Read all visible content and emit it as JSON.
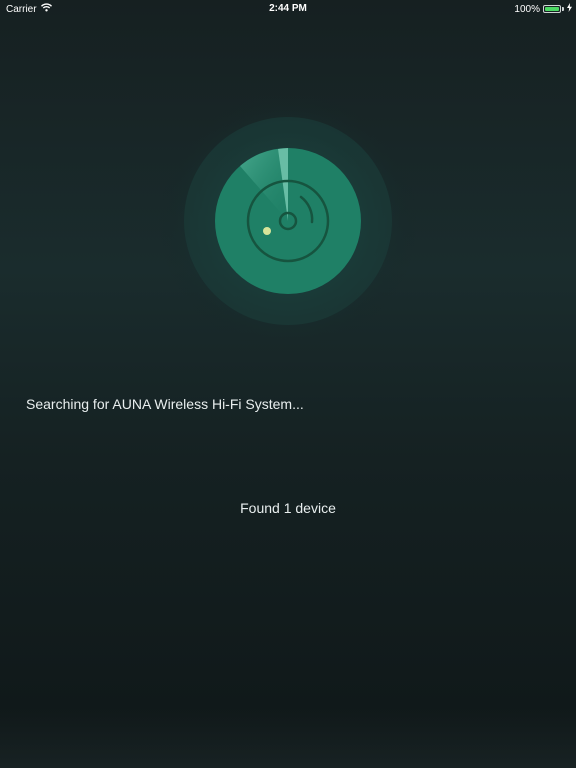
{
  "status_bar": {
    "carrier": "Carrier",
    "time": "2:44 PM",
    "battery_percent": "100%",
    "battery_level": 1.0,
    "icons": [
      "wifi-icon",
      "battery-icon",
      "charging-bolt-icon"
    ]
  },
  "radar": {
    "icons": [
      "radar-scanner-icon"
    ],
    "colors": {
      "disc": "#1f8066",
      "halo": "#1d4a46",
      "ring": "#16543f",
      "dot": "#d7e59a"
    }
  },
  "main": {
    "searching_label": "Searching for AUNA Wireless Hi-Fi System...",
    "found_label": "Found 1 device"
  }
}
